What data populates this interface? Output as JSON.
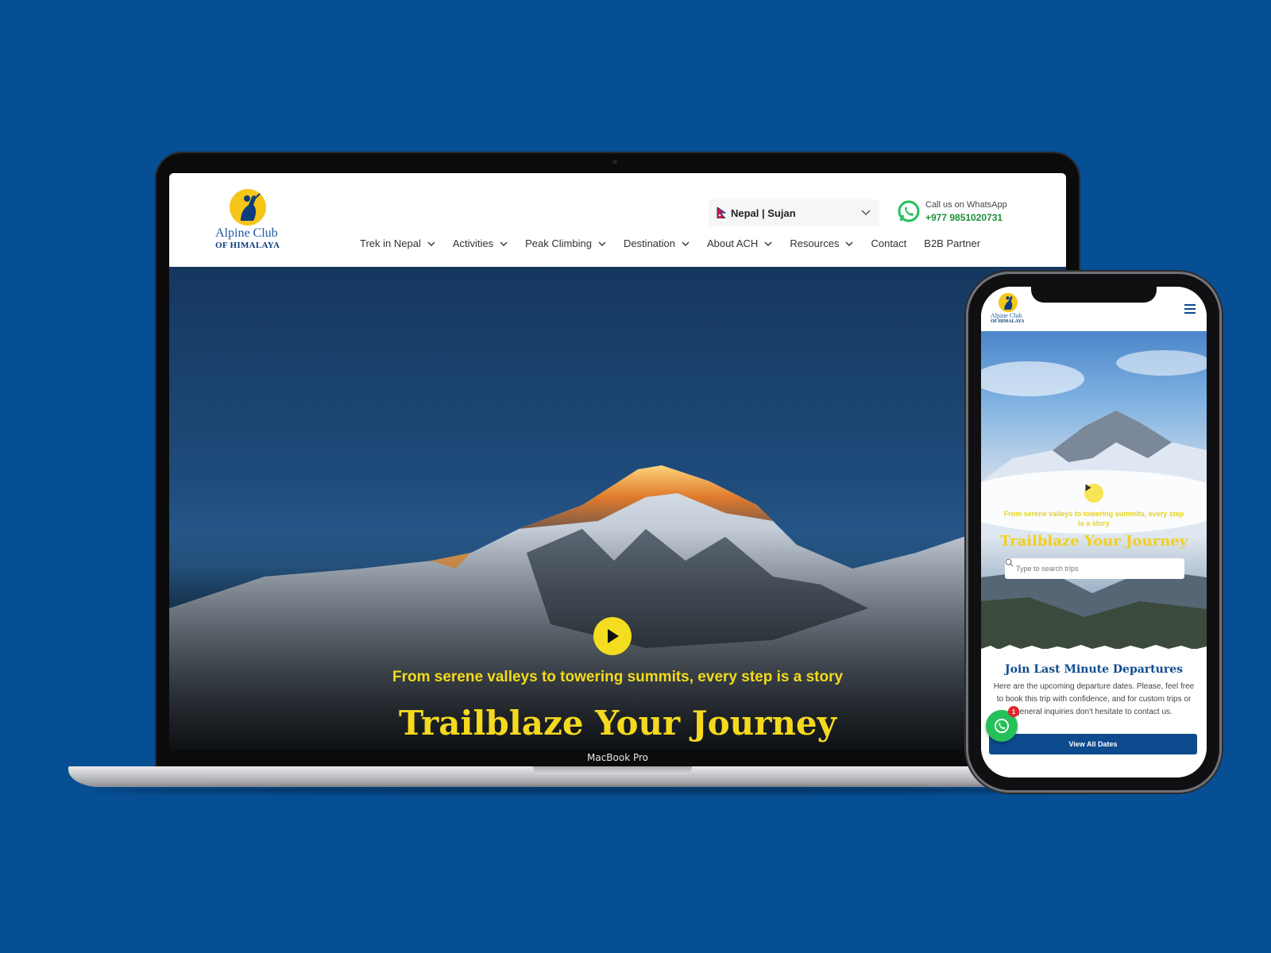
{
  "brand": {
    "name_line1": "Alpine Club",
    "name_line2": "OF HIMALAYA",
    "accent": "#f5c518",
    "primary": "#0d4a8e",
    "background": "#064f94"
  },
  "header": {
    "locale": "Nepal | Sujan",
    "whatsapp_label": "Call us on WhatsApp",
    "whatsapp_phone": "+977 9851020731"
  },
  "nav": [
    {
      "label": "Trek in Nepal",
      "dropdown": true
    },
    {
      "label": "Activities",
      "dropdown": true
    },
    {
      "label": "Peak Climbing",
      "dropdown": true
    },
    {
      "label": "Destination",
      "dropdown": true
    },
    {
      "label": "About ACH",
      "dropdown": true
    },
    {
      "label": "Resources",
      "dropdown": true
    },
    {
      "label": "Contact",
      "dropdown": false
    },
    {
      "label": "B2B Partner",
      "dropdown": false
    }
  ],
  "hero": {
    "subtitle": "From serene valleys to towering summits, every step is a story",
    "title": "Trailblaze Your Journey"
  },
  "device": {
    "laptop_model": "MacBook Pro"
  },
  "mobile": {
    "hero_subtitle": "From serene valleys to towering summits, every step is a story",
    "hero_title": "Trailblaze Your Journey",
    "search_placeholder": "Type to search trips",
    "section_title": "Join Last Minute Departures",
    "section_text": "Here are the upcoming departure dates. Please, feel free to book this trip with confidence, and for custom trips or general inquiries don't hesitate to contact us.",
    "cta": "View All Dates",
    "whatsapp_badge": "1"
  }
}
